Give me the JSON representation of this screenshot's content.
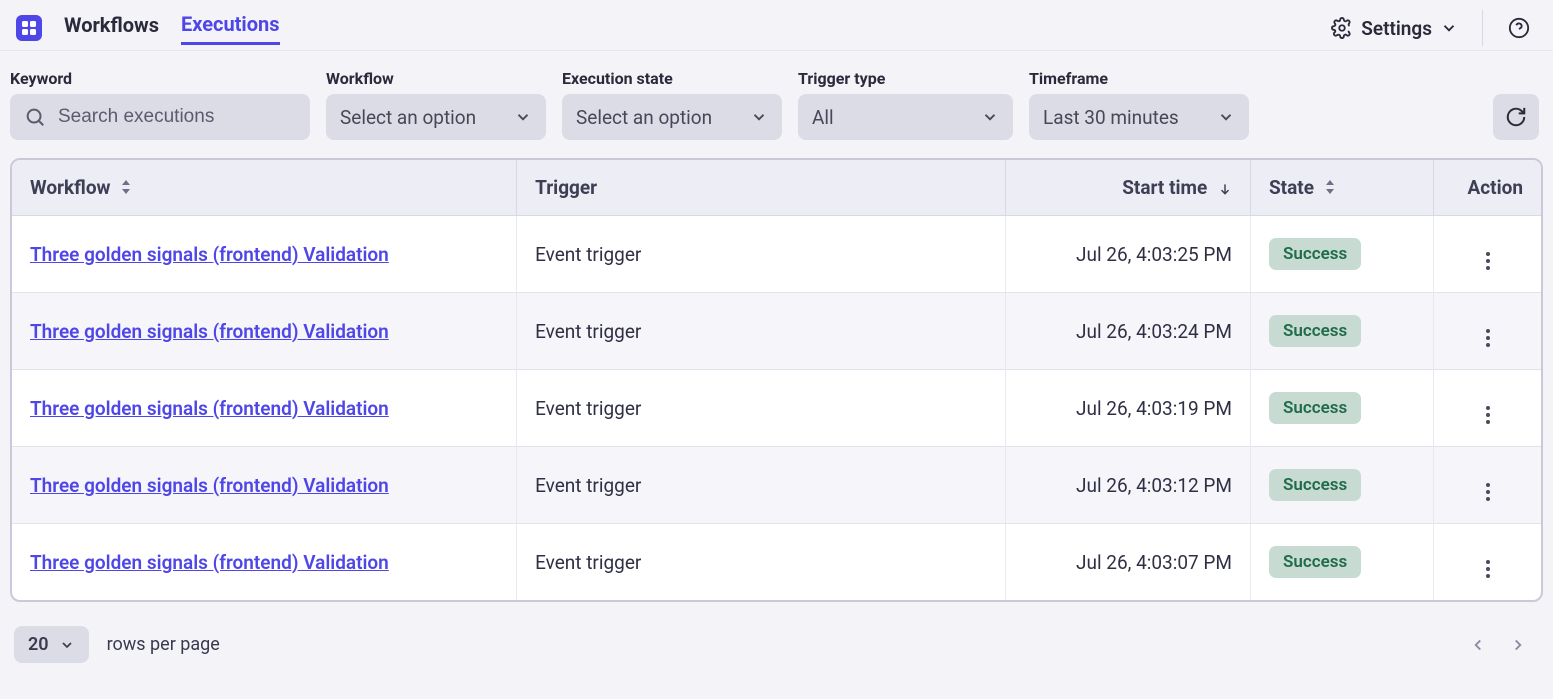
{
  "nav": {
    "workflows": "Workflows",
    "executions": "Executions",
    "settings": "Settings"
  },
  "filters": {
    "keyword_label": "Keyword",
    "keyword_placeholder": "Search executions",
    "workflow_label": "Workflow",
    "workflow_value": "Select an option",
    "state_label": "Execution state",
    "state_value": "Select an option",
    "trigger_label": "Trigger type",
    "trigger_value": "All",
    "timeframe_label": "Timeframe",
    "timeframe_value": "Last 30 minutes"
  },
  "table": {
    "headers": {
      "workflow": "Workflow",
      "trigger": "Trigger",
      "start": "Start time",
      "state": "State",
      "action": "Action"
    },
    "rows": [
      {
        "workflow": "Three golden signals (frontend) Validation",
        "trigger": "Event trigger",
        "start": "Jul 26, 4:03:25 PM",
        "state": "Success"
      },
      {
        "workflow": "Three golden signals (frontend) Validation",
        "trigger": "Event trigger",
        "start": "Jul 26, 4:03:24 PM",
        "state": "Success"
      },
      {
        "workflow": "Three golden signals (frontend) Validation",
        "trigger": "Event trigger",
        "start": "Jul 26, 4:03:19 PM",
        "state": "Success"
      },
      {
        "workflow": "Three golden signals (frontend) Validation",
        "trigger": "Event trigger",
        "start": "Jul 26, 4:03:12 PM",
        "state": "Success"
      },
      {
        "workflow": "Three golden signals (frontend) Validation",
        "trigger": "Event trigger",
        "start": "Jul 26, 4:03:07 PM",
        "state": "Success"
      }
    ]
  },
  "pagination": {
    "page_size": "20",
    "rows_label": "rows per page"
  }
}
